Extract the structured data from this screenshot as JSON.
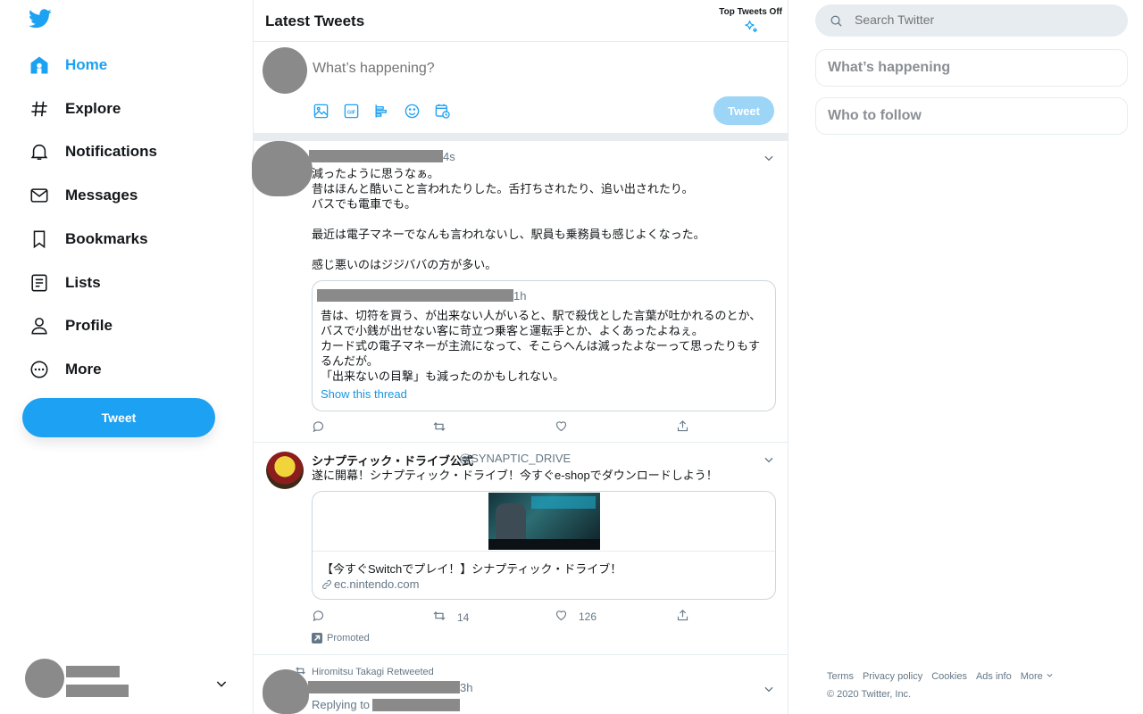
{
  "nav": {
    "items": [
      {
        "label": "Home",
        "icon": "home-icon"
      },
      {
        "label": "Explore",
        "icon": "hashtag-icon"
      },
      {
        "label": "Notifications",
        "icon": "bell-icon"
      },
      {
        "label": "Messages",
        "icon": "envelope-icon"
      },
      {
        "label": "Bookmarks",
        "icon": "bookmark-icon"
      },
      {
        "label": "Lists",
        "icon": "list-icon"
      },
      {
        "label": "Profile",
        "icon": "person-icon"
      },
      {
        "label": "More",
        "icon": "more-circle-icon"
      }
    ],
    "tweet_button": "Tweet"
  },
  "timeline": {
    "title": "Latest Tweets",
    "top_tweets_toggle": "Top Tweets Off",
    "compose_placeholder": "What’s happening?",
    "compose_tweet_button": "Tweet"
  },
  "tweets": [
    {
      "time": "4s",
      "text": "減ったように思うなぁ。\n昔はほんと酷いこと言われたりした。舌打ちされたり、追い出されたり。\nバスでも電車でも。\n\n最近は電子マネーでなんも言われないし、駅員も乗務員も感じよくなった。\n\n感じ悪いのはジジババの方が多い。",
      "quote": {
        "time": "1h",
        "text": "昔は、切符を買う、が出来ない人がいると、駅で殺伐とした言葉が吐かれるのとか、\nバスで小銭が出せない客に苛立つ乗客と運転手とか、よくあったよねぇ。\nカード式の電子マネーが主流になって、そこらへんは減ったよなーって思ったりもするんだが。\n「出来ないの目撃」も減ったのかもしれない。",
        "show_thread": "Show this thread"
      }
    },
    {
      "author": "シナプティック・ドライブ公式",
      "handle": "@SYNAPTIC_DRIVE",
      "text": "遂に開幕！シナプティック・ドライブ！今すぐe-shopでダウンロードしよう！",
      "card": {
        "title": "【今すぐSwitchでプレイ！】シナプティック・ドライブ！",
        "domain": "ec.nintendo.com"
      },
      "retweets": "14",
      "likes": "126",
      "promoted": "Promoted"
    },
    {
      "retweeted_by": "Hiromitsu Takagi Retweeted",
      "time": "3h",
      "replying_to": "Replying to"
    }
  ],
  "right": {
    "search_placeholder": "Search Twitter",
    "whats_happening": "What’s happening",
    "who_to_follow": "Who to follow",
    "footer": [
      "Terms",
      "Privacy policy",
      "Cookies",
      "Ads info",
      "More"
    ],
    "copyright": "© 2020 Twitter, Inc."
  },
  "colors": {
    "accent": "#1da1f2",
    "text": "#14171a",
    "muted": "#657786",
    "border": "#e6ecf0"
  }
}
